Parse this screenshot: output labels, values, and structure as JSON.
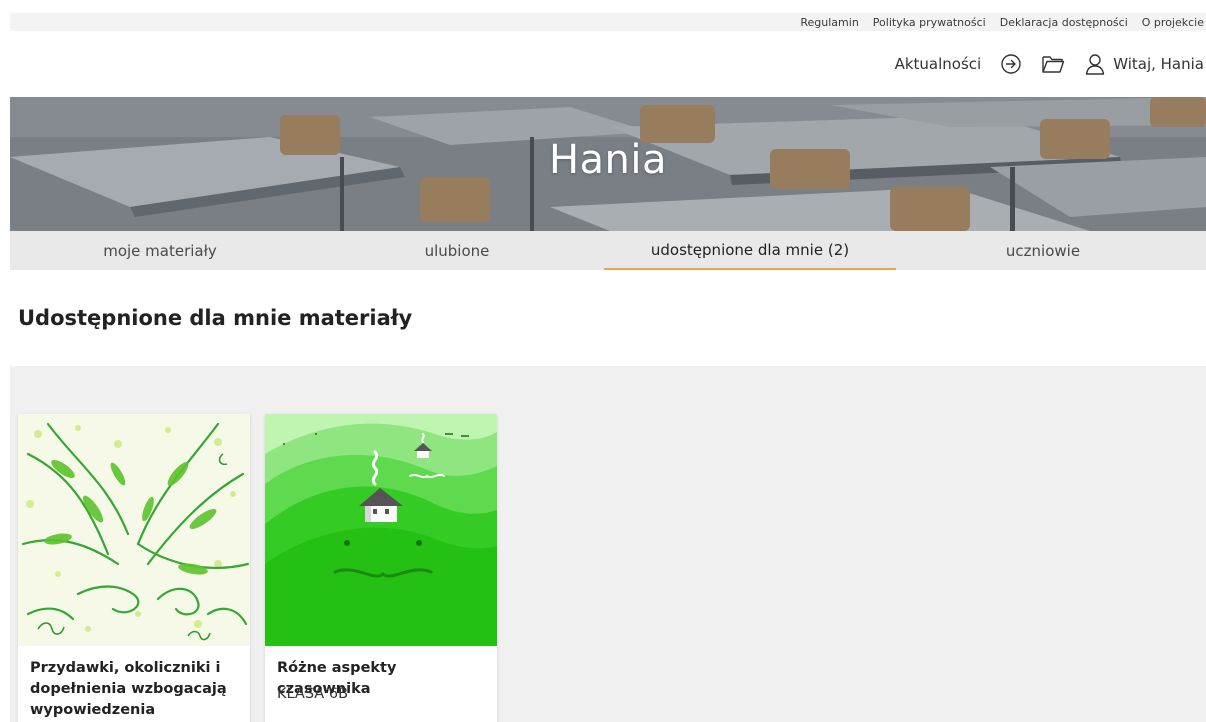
{
  "top_links": [
    "Regulamin",
    "Polityka prywatności",
    "Deklaracja dostępności",
    "O projekcie"
  ],
  "nav": {
    "news": "Aktualności",
    "login_icon": "arrow-circle-right-icon",
    "folder_icon": "folder-icon",
    "user_icon": "user-icon",
    "greeting": "Witaj, Hania"
  },
  "hero": {
    "title": "Hania"
  },
  "tabs": [
    {
      "label": "moje materiały",
      "active": false
    },
    {
      "label": "ulubione",
      "active": false
    },
    {
      "label": "udostępnione dla mnie (2)",
      "active": true
    },
    {
      "label": "uczniowie",
      "active": false
    }
  ],
  "section_title": "Udostępnione dla mnie materiały",
  "cards": [
    {
      "title": "Przydawki, okoliczniki i dopełnienia wzbogacają wypowiedzenia",
      "subtitle": ""
    },
    {
      "title": "Różne aspekty czasownika",
      "subtitle": "KLASA 6B"
    }
  ],
  "colors": {
    "accent": "#f2a24a",
    "tab_bg": "#e9e9e9",
    "gallery_bg": "#f0f0f0",
    "green": "#2ecc1f"
  }
}
